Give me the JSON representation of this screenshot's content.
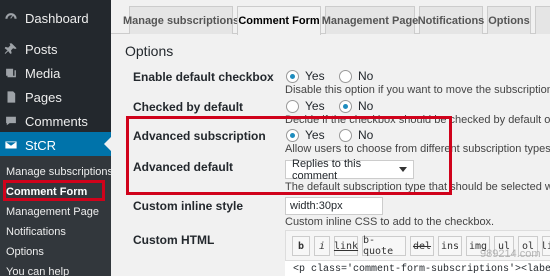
{
  "sidebar": {
    "items": [
      {
        "label": "Dashboard",
        "icon": "dashboard-icon"
      },
      {
        "label": "Posts",
        "icon": "pin-icon"
      },
      {
        "label": "Media",
        "icon": "media-icon"
      },
      {
        "label": "Pages",
        "icon": "pages-icon"
      },
      {
        "label": "Comments",
        "icon": "comments-icon"
      },
      {
        "label": "StCR",
        "icon": "mail-icon"
      }
    ],
    "submenu": [
      "Manage subscriptions",
      "Comment Form",
      "Management Page",
      "Notifications",
      "Options",
      "You can help"
    ]
  },
  "tabs": [
    "Manage subscriptions",
    "Comment Form",
    "Management Page",
    "Notifications",
    "Options"
  ],
  "section_title": "Options",
  "fields": {
    "enable_default": {
      "label": "Enable default checkbox",
      "yes": "Yes",
      "no": "No",
      "selected": "Yes",
      "desc": "Disable this option if you want to move the subscription c"
    },
    "checked_default": {
      "label": "Checked by default",
      "yes": "Yes",
      "no": "No",
      "selected": "No",
      "desc": "Decide if the checkbox should be checked by default or n"
    },
    "advanced_subscription": {
      "label": "Advanced subscription",
      "yes": "Yes",
      "no": "No",
      "selected": "Yes",
      "desc": "Allow users to choose from different subscription types ("
    },
    "advanced_default": {
      "label": "Advanced default",
      "value": "Replies to this comment",
      "desc": "The default subscription type that should be selected wh"
    },
    "custom_inline": {
      "label": "Custom inline style",
      "value": "width:30px",
      "desc": "Custom inline CSS to add to the checkbox."
    },
    "custom_html": {
      "label": "Custom HTML",
      "buttons": [
        "b",
        "i",
        "link",
        "b-quote",
        "del",
        "ins",
        "img",
        "ul",
        "ol",
        "li"
      ],
      "code": "<p class='comment-form-subscriptions'><label fo"
    }
  },
  "watermark": "989214.com",
  "colors": {
    "accent": "#0073aa",
    "highlight": "#d0021b",
    "sidebar": "#23282d"
  }
}
